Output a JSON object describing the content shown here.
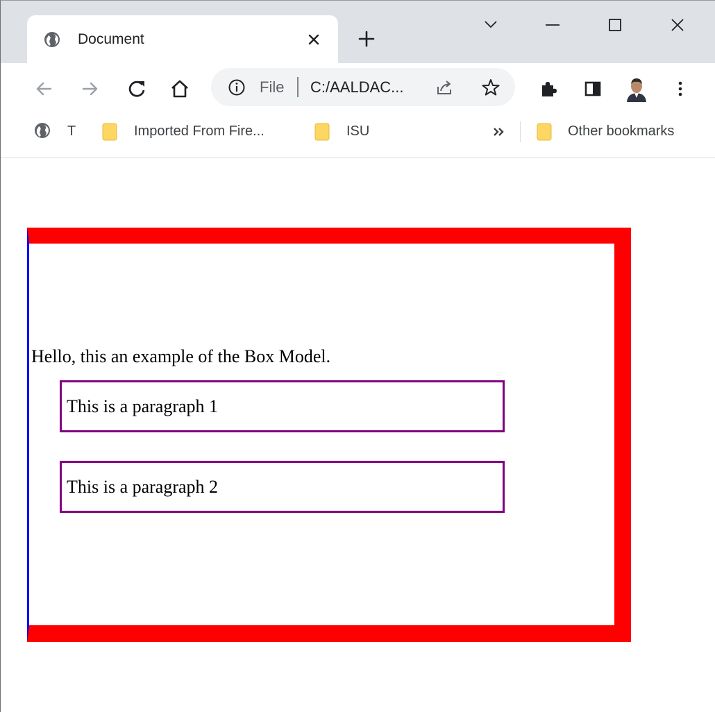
{
  "browser": {
    "tab": {
      "title": "Document"
    },
    "omnibox": {
      "scheme": "File",
      "url": "C:/AALDAC..."
    },
    "bookmarks": [
      {
        "label": "T",
        "icon": "globe-icon"
      },
      {
        "label": "Imported From Fire...",
        "icon": "folder-icon"
      },
      {
        "label": "ISU",
        "icon": "folder-icon"
      }
    ],
    "other_bookmarks": "Other bookmarks",
    "icons": {
      "back": "arrow-left-icon",
      "forward": "arrow-right-icon",
      "reload": "reload-icon",
      "home": "home-icon",
      "info": "info-icon",
      "share": "share-icon",
      "star": "star-icon",
      "extensions": "puzzle-icon",
      "side_panel": "side-panel-icon",
      "profile": "avatar",
      "menu": "kebab-menu-icon",
      "new_tab": "plus-icon",
      "close": "close-icon",
      "minimize": "minimize-icon",
      "maximize": "maximize-icon",
      "tab_search": "chevron-down-icon"
    },
    "colors": {
      "tabstrip": "#dee1e6",
      "omnibox": "#f1f3f4",
      "folder": "#fdd663"
    }
  },
  "page": {
    "intro": "Hello, this an example of the Box Model.",
    "paragraphs": [
      "This is a paragraph 1",
      "This is a paragraph 2"
    ],
    "colors": {
      "outer_border": "#ff0000",
      "outer_left_border": "#0000ff",
      "paragraph_border": "#800080"
    }
  }
}
